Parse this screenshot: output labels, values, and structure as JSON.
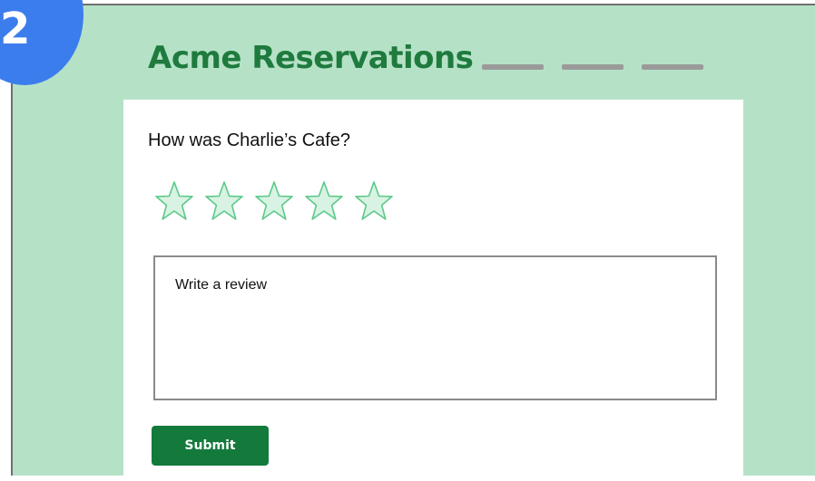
{
  "step_badge": {
    "number": "2",
    "color": "#3b7ded"
  },
  "header": {
    "brand": "Acme Reservations",
    "nav_placeholders": [
      "nav-placeholder-1",
      "nav-placeholder-2",
      "nav-placeholder-3"
    ]
  },
  "review_form": {
    "question": "How was Charlie’s Cafe?",
    "rating": {
      "selected": 0,
      "max": 5,
      "icon": "star-outline-icon"
    },
    "review_input": {
      "placeholder": "Write a review",
      "value": ""
    },
    "submit_label": "Submit"
  },
  "colors": {
    "page_background": "#b5e2c7",
    "brand": "#1f7a3e",
    "star_fill": "#d8f3e3",
    "star_stroke": "#5cc98a",
    "button": "#137a3c"
  }
}
